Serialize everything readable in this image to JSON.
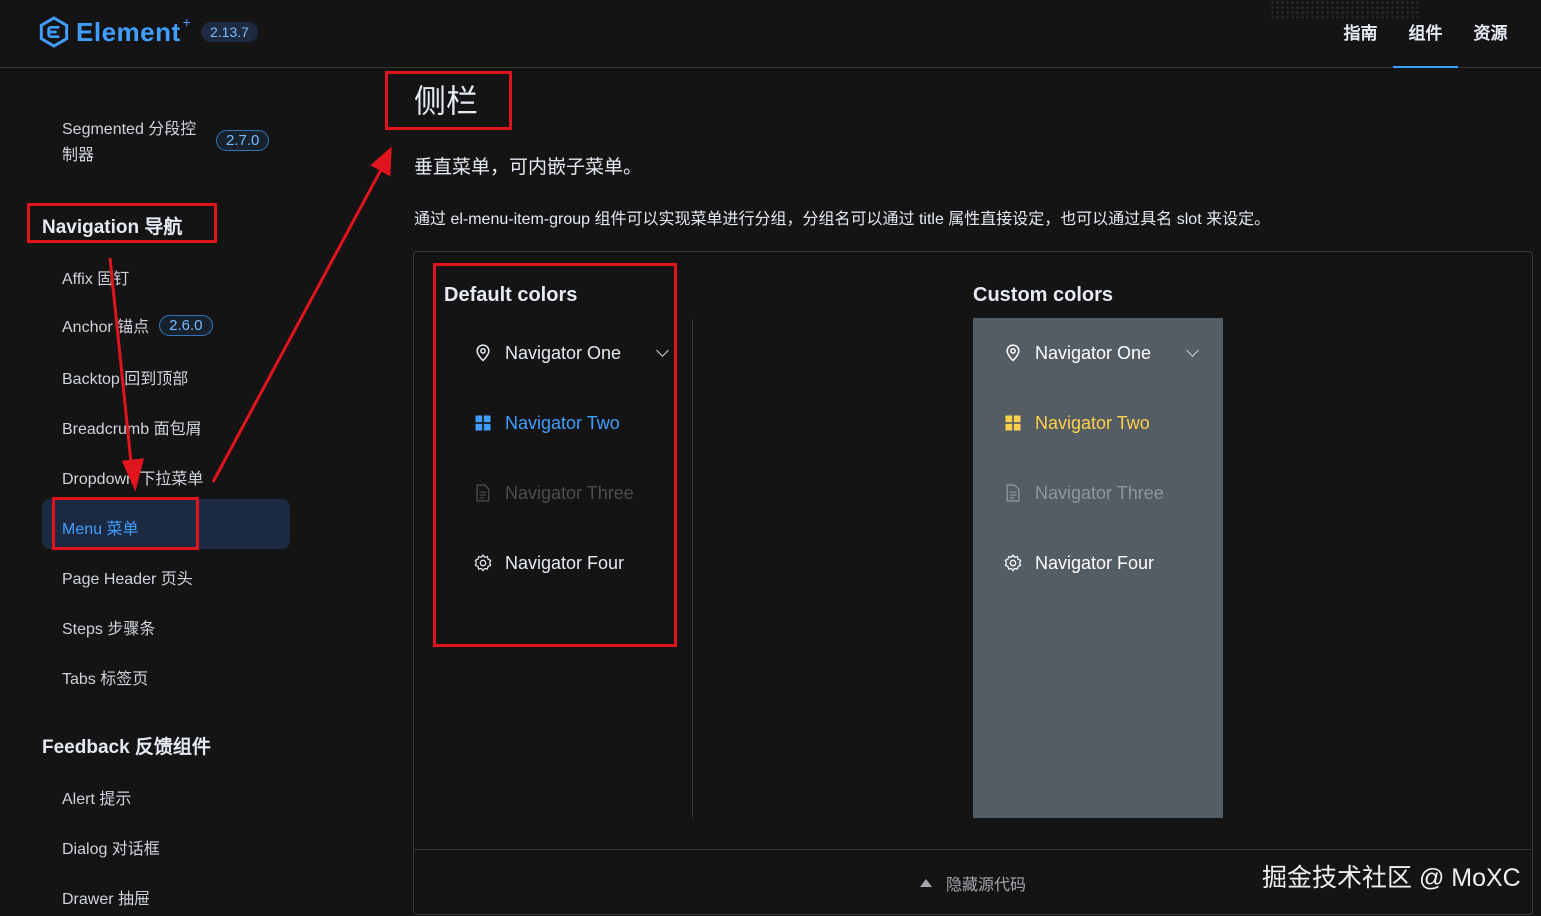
{
  "header": {
    "logo_text": "Element",
    "logo_sup": "+",
    "version": "2.13.7",
    "nav": [
      {
        "label": "指南"
      },
      {
        "label": "组件"
      },
      {
        "label": "资源"
      }
    ],
    "active_nav": "组件"
  },
  "sidebar": {
    "segmented": {
      "label_line1": "Segmented 分段控",
      "label_line2": "制器",
      "version": "2.7.0"
    },
    "groups": [
      {
        "title": "Navigation 导航",
        "items": [
          {
            "label": "Affix 固钉"
          },
          {
            "label": "Anchor 锚点",
            "version": "2.6.0"
          },
          {
            "label": "Backtop 回到顶部"
          },
          {
            "label": "Breadcrumb 面包屑"
          },
          {
            "label": "Dropdown 下拉菜单"
          },
          {
            "label": "Menu 菜单",
            "active": true
          },
          {
            "label": "Page Header 页头"
          },
          {
            "label": "Steps 步骤条"
          },
          {
            "label": "Tabs 标签页"
          }
        ]
      },
      {
        "title": "Feedback 反馈组件",
        "items": [
          {
            "label": "Alert 提示"
          },
          {
            "label": "Dialog 对话框"
          },
          {
            "label": "Drawer 抽屉"
          }
        ]
      }
    ]
  },
  "main": {
    "title": "侧栏",
    "description": "垂直菜单，可内嵌子菜单。",
    "detail": "通过 el-menu-item-group 组件可以实现菜单进行分组，分组名可以通过 title 属性直接设定，也可以通过具名 slot 来设定。",
    "demo": {
      "default_title": "Default colors",
      "custom_title": "Custom colors",
      "menu_items": [
        {
          "label": "Navigator One",
          "icon": "location-icon",
          "state": "submenu"
        },
        {
          "label": "Navigator Two",
          "icon": "menu-grid-icon",
          "state": "active"
        },
        {
          "label": "Navigator Three",
          "icon": "document-icon",
          "state": "disabled"
        },
        {
          "label": "Navigator Four",
          "icon": "setting-icon",
          "state": "normal"
        }
      ],
      "custom_colors": {
        "background": "#545c64",
        "text": "#ffffff",
        "active_text": "#ffd04b"
      },
      "default_colors": {
        "active_text": "#409eff"
      },
      "footer_label": "隐藏源代码"
    }
  },
  "annotation_color": "#e0141d",
  "watermark": "掘金技术社区 @ MoXC"
}
